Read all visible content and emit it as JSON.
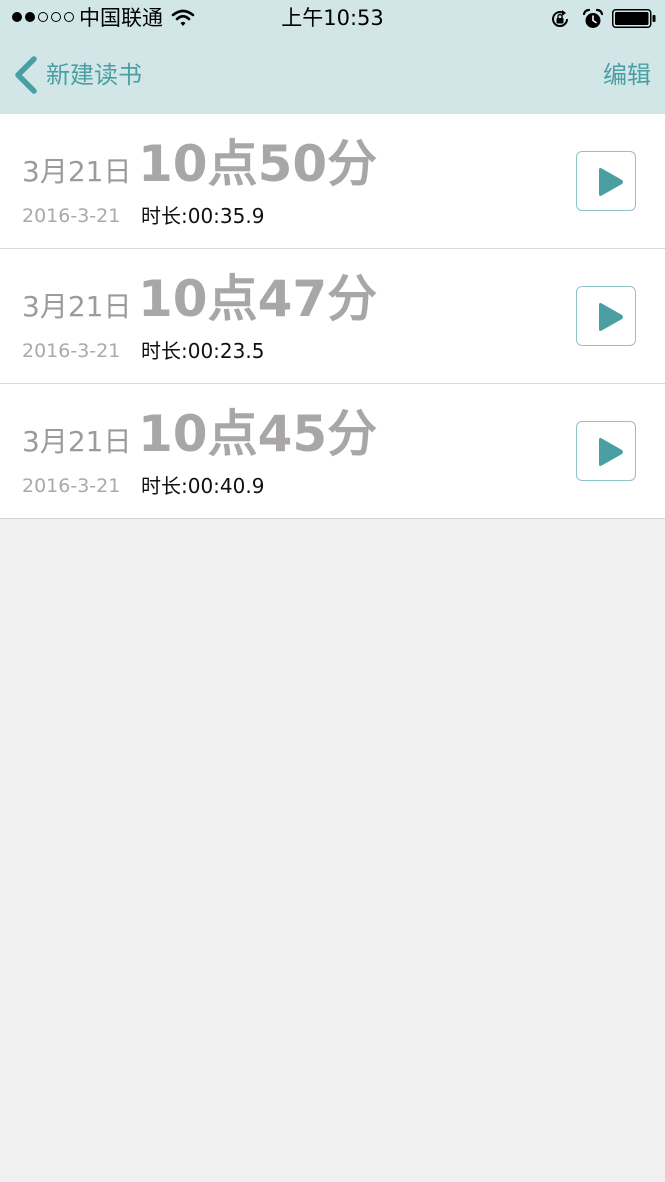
{
  "status_bar": {
    "carrier": "中国联通",
    "time": "上午10:53",
    "signal_strength": 2,
    "signal_max": 5
  },
  "nav": {
    "back_label": "新建读书",
    "edit_label": "编辑"
  },
  "colors": {
    "accent": "#4a9fa3",
    "nav_background": "#d2e6e8",
    "page_background": "#f0f0f0"
  },
  "recordings": [
    {
      "date": "3月21日",
      "time": "10点50分",
      "full_date": "2016-3-21",
      "duration": "时长:00:35.9"
    },
    {
      "date": "3月21日",
      "time": "10点47分",
      "full_date": "2016-3-21",
      "duration": "时长:00:23.5"
    },
    {
      "date": "3月21日",
      "time": "10点45分",
      "full_date": "2016-3-21",
      "duration": "时长:00:40.9"
    }
  ]
}
